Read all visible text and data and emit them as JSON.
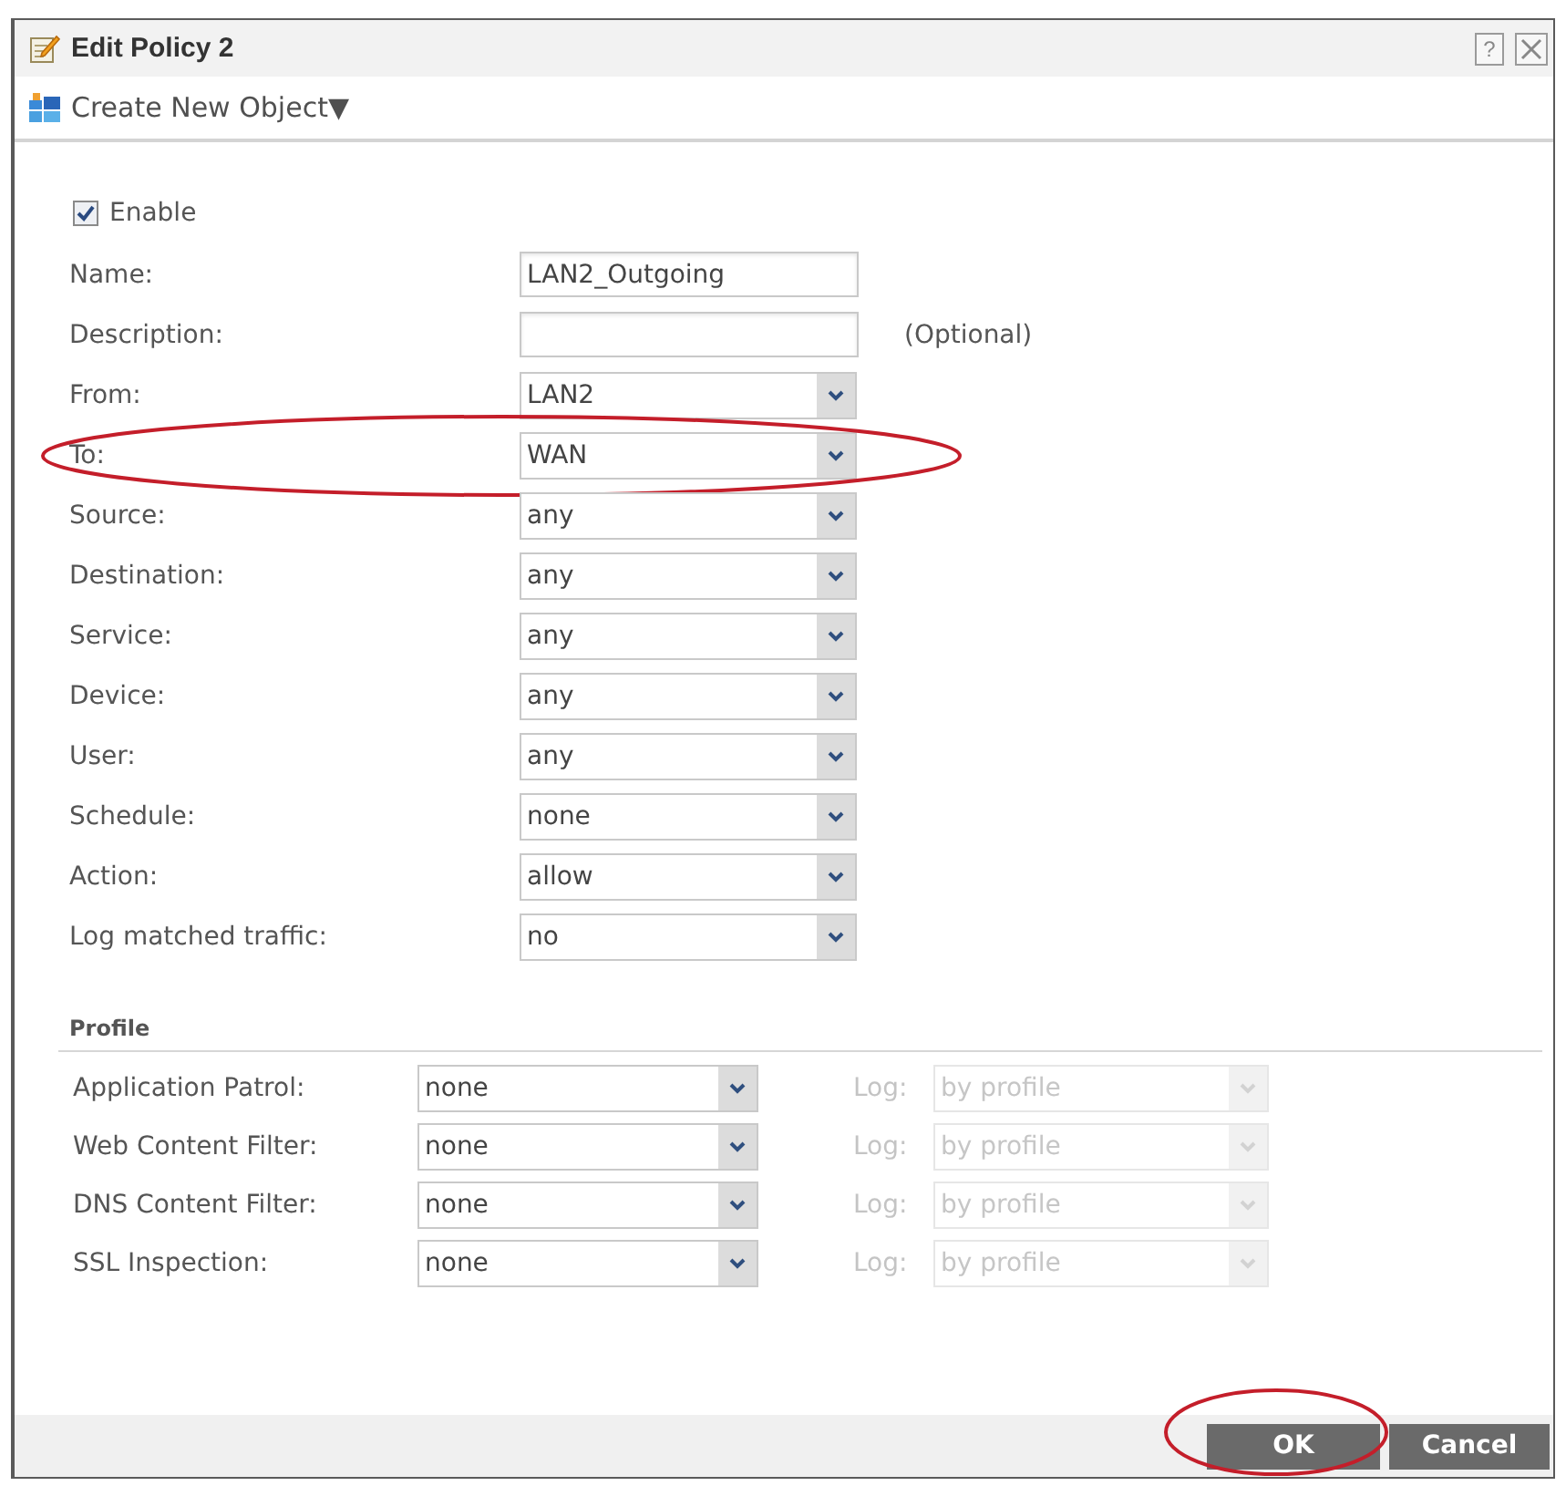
{
  "window": {
    "title": "Edit Policy 2",
    "help": "?"
  },
  "toolbar": {
    "menu": "Create New Object▼"
  },
  "enable": {
    "label": "Enable",
    "checked": true
  },
  "fields": [
    {
      "kind": "text",
      "label": "Name:",
      "value": "LAN2_Outgoing",
      "circled": false
    },
    {
      "kind": "text",
      "label": "Description:",
      "note": "(Optional)",
      "circled": false
    },
    {
      "kind": "select",
      "label": "From:",
      "value": "LAN2",
      "circled": false
    },
    {
      "kind": "select",
      "label": "To:",
      "value": "WAN",
      "circled": true
    },
    {
      "kind": "select",
      "label": "Source:",
      "value": "any",
      "circled": false
    },
    {
      "kind": "select",
      "label": "Destination:",
      "value": "any",
      "circled": false
    },
    {
      "kind": "select",
      "label": "Service:",
      "value": "any",
      "circled": false
    },
    {
      "kind": "select",
      "label": "Device:",
      "value": "any",
      "circled": false
    },
    {
      "kind": "select",
      "label": "User:",
      "value": "any",
      "circled": false
    },
    {
      "kind": "select",
      "label": "Schedule:",
      "value": "none",
      "circled": false
    },
    {
      "kind": "select",
      "label": "Action:",
      "value": "allow",
      "circled": false
    },
    {
      "kind": "select",
      "label": "Log matched traffic:",
      "value": "no",
      "circled": false
    }
  ],
  "profile": {
    "title": "Profile",
    "rows": [
      {
        "label": "Application Patrol:",
        "value": "none",
        "log_label": "Log:",
        "log_value": "by profile",
        "log_disabled": true
      },
      {
        "label": "Web Content Filter:",
        "value": "none",
        "log_label": "Log:",
        "log_value": "by profile",
        "log_disabled": true
      },
      {
        "label": "DNS Content Filter:",
        "value": "none",
        "log_label": "Log:",
        "log_value": "by profile",
        "log_disabled": true
      },
      {
        "label": "SSL Inspection:",
        "value": "none",
        "log_label": "Log:",
        "log_value": "by profile",
        "log_disabled": true
      }
    ]
  },
  "buttons": [
    {
      "label": "OK",
      "circled": true
    },
    {
      "label": "Cancel",
      "circled": false
    }
  ]
}
